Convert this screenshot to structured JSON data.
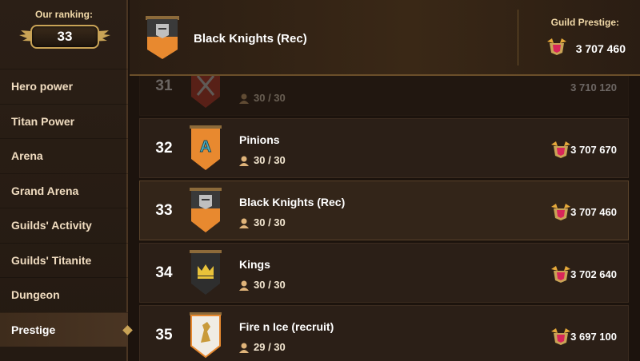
{
  "sidebar": {
    "ranking_label": "Our ranking:",
    "ranking_value": "33",
    "items": [
      {
        "label": "Hero power"
      },
      {
        "label": "Titan Power"
      },
      {
        "label": "Arena"
      },
      {
        "label": "Grand Arena"
      },
      {
        "label": "Guilds' Activity"
      },
      {
        "label": "Guilds' Titanite"
      },
      {
        "label": "Dungeon"
      },
      {
        "label": "Prestige",
        "active": true
      }
    ]
  },
  "header": {
    "guild_name": "Black Knights (Rec)",
    "prestige_label": "Guild Prestige:",
    "prestige_value": "3 707 460"
  },
  "rows": [
    {
      "rank": "31",
      "name": "",
      "members": "30 / 30",
      "prestige": "3 710 120",
      "emblem": "crossed-swords-icon",
      "banner_color": "#c93a2b"
    },
    {
      "rank": "32",
      "name": "Pinions",
      "members": "30 / 30",
      "prestige": "3 707 670",
      "emblem": "letter-a-icon",
      "banner_color": "#e8892f"
    },
    {
      "rank": "33",
      "name": "Black Knights (Rec)",
      "members": "30 / 30",
      "prestige": "3 707 460",
      "emblem": "helmet-icon",
      "banner_color": "#3a3a3a"
    },
    {
      "rank": "34",
      "name": "Kings",
      "members": "30 / 30",
      "prestige": "3 702 640",
      "emblem": "crown-icon",
      "banner_color": "#2e2e2e"
    },
    {
      "rank": "35",
      "name": "Fire n Ice (recruit)",
      "members": "29 / 30",
      "prestige": "3 697 100",
      "emblem": "dragon-icon",
      "banner_color": "#f0ece4"
    }
  ]
}
